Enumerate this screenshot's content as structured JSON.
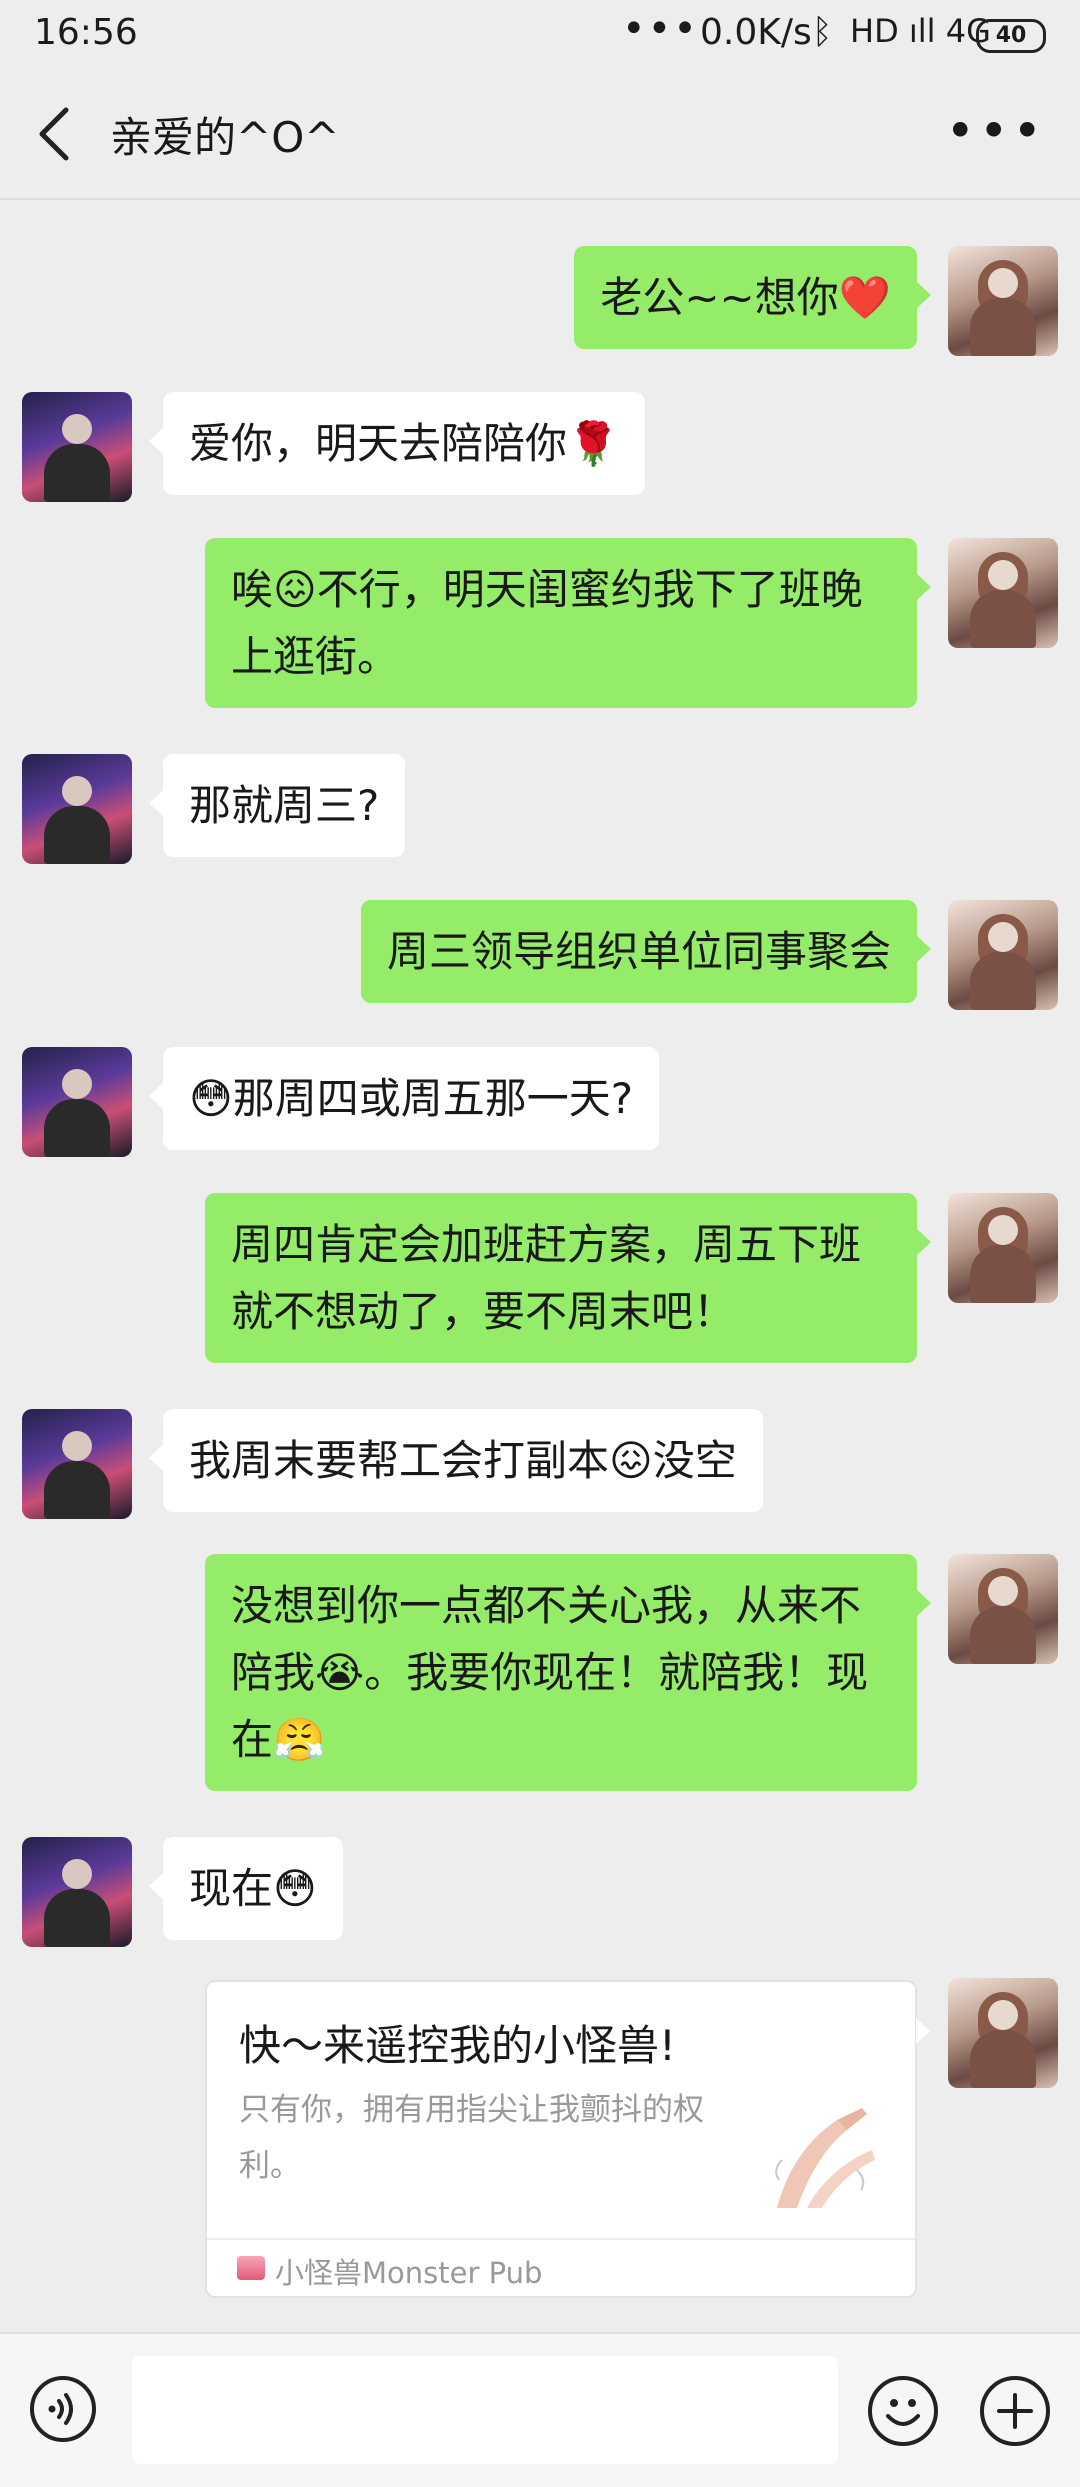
{
  "status_bar": {
    "time": "16:56",
    "dots": "•••",
    "network_speed": "0.0K/s",
    "bluetooth": "ᛒ",
    "signal": "HD ıll 4G",
    "battery": "40"
  },
  "header": {
    "title": "亲爱的^O^"
  },
  "messages": [
    {
      "side": "right",
      "text": "老公~~想你❤️"
    },
    {
      "side": "left",
      "text": "爱你，明天去陪陪你🌹"
    },
    {
      "side": "right",
      "text": "唉😖不行，明天闺蜜约我下了班晚上逛街。"
    },
    {
      "side": "left",
      "text": "那就周三?"
    },
    {
      "side": "right",
      "text": "周三领导组织单位同事聚会"
    },
    {
      "side": "left",
      "text": "😳那周四或周五那一天?"
    },
    {
      "side": "right",
      "text": "周四肯定会加班赶方案，周五下班就不想动了，要不周末吧！"
    },
    {
      "side": "left",
      "text": "我周末要帮工会打副本😖没空"
    },
    {
      "side": "right",
      "text": "没想到你一点都不关心我，从来不陪我😭。我要你现在！就陪我！现在😤"
    },
    {
      "side": "left",
      "text": "现在😳"
    }
  ],
  "share_card": {
    "title": "快～来遥控我的小怪兽!",
    "description": "只有你，拥有用指尖让我颤抖的权利。",
    "source": "小怪兽Monster Pub"
  },
  "input_bar": {
    "placeholder": ""
  },
  "colors": {
    "background": "#ededed",
    "sent_bubble": "#95ec69",
    "received_bubble": "#ffffff"
  }
}
